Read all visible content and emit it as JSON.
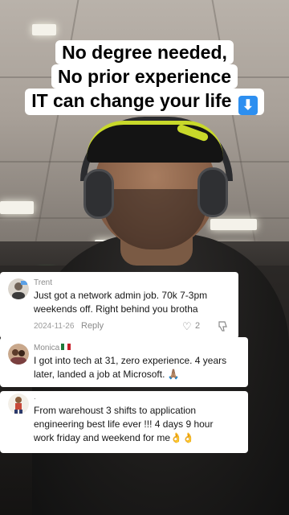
{
  "headline": {
    "lines": [
      "No degree needed,",
      "No prior experience",
      "IT can change your life"
    ],
    "emoji_icon": "down-arrow-emoji-icon",
    "emoji_glyph": "⬇"
  },
  "comments": [
    {
      "author": "Trent",
      "text_line1": "Just got a network admin job. 70k 7-3pm",
      "text_line2": "weekends off. Right behind you brotha",
      "date": "2024-11-26",
      "reply_label": "Reply",
      "likes": "2",
      "avatar_icon": "user-avatar-icon"
    },
    {
      "author": "Monica",
      "flag_icon": "mexico-flag-icon",
      "text_line1": "I got into tech at 31, zero experience. 4 years",
      "text_line2": "later, landed a job at Microsoft. 🙏🏽",
      "avatar_icon": "user-avatar-icon"
    },
    {
      "author": ".",
      "text_line1": "From warehoust 3 shifts to application",
      "text_line2": "engineering best life ever !!! 4 days 9 hour",
      "text_line3": "work friday and weekend for me👌👌",
      "avatar_icon": "user-avatar-icon"
    }
  ],
  "colors": {
    "card_bg": "#ffffff",
    "text": "#161616",
    "muted": "#8a8a8a",
    "emoji_blue": "#2d8ff0",
    "cap_accent": "#c8d92a"
  }
}
